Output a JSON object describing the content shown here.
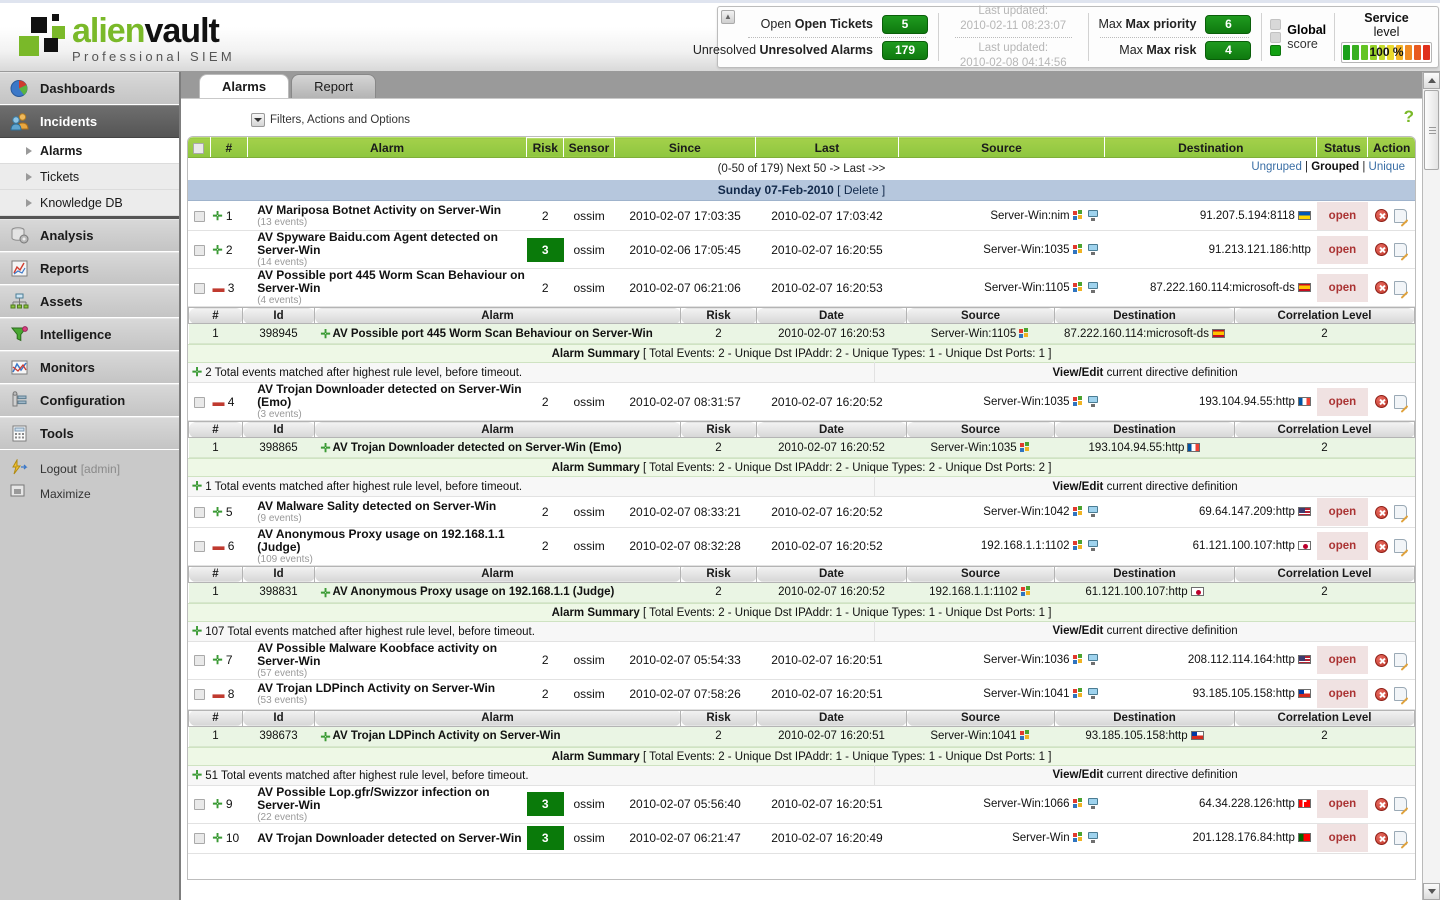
{
  "brand": {
    "name_green": "alien",
    "name_dark": "vault",
    "tagline": "Professional SIEM"
  },
  "status_panel": {
    "open_tickets_label": "Open Tickets",
    "open_tickets_value": "5",
    "unresolved_alarms_label": "Unresolved Alarms",
    "unresolved_alarms_value": "179",
    "last_updated_label_1": "Last updated:",
    "last_updated_value_1": "2010-02-11 08:23:07",
    "last_updated_label_2": "Last updated:",
    "last_updated_value_2": "2010-02-08 04:14:56",
    "max_priority_label": "Max priority",
    "max_priority_value": "6",
    "max_risk_label": "Max risk",
    "max_risk_value": "4",
    "global_label": "Global",
    "score_label": "score",
    "service_label": "Service",
    "level_label": "level",
    "service_level_value": "100 %",
    "pill_color": "#117a11"
  },
  "sidebar": {
    "items": [
      {
        "label": "Dashboards",
        "icon": "pie-chart-icon",
        "active": false
      },
      {
        "label": "Incidents",
        "icon": "people-icon",
        "active": true
      },
      {
        "label": "Analysis",
        "icon": "database-gear-icon",
        "active": false
      },
      {
        "label": "Reports",
        "icon": "report-chart-icon",
        "active": false
      },
      {
        "label": "Assets",
        "icon": "network-nodes-icon",
        "active": false
      },
      {
        "label": "Intelligence",
        "icon": "funnel-icon",
        "active": false
      },
      {
        "label": "Monitors",
        "icon": "line-chart-icon",
        "active": false
      },
      {
        "label": "Configuration",
        "icon": "wrench-icon",
        "active": false
      },
      {
        "label": "Tools",
        "icon": "calculator-icon",
        "active": false
      }
    ],
    "subitems": [
      {
        "label": "Alarms",
        "current": true
      },
      {
        "label": "Tickets",
        "current": false
      },
      {
        "label": "Knowledge DB",
        "current": false
      }
    ],
    "footer": [
      {
        "label": "Logout",
        "suffix": "[admin]",
        "icon": "logout-icon"
      },
      {
        "label": "Maximize",
        "suffix": "",
        "icon": "maximize-icon"
      }
    ]
  },
  "tabs": [
    {
      "label": "Alarms",
      "active": true
    },
    {
      "label": "Report",
      "active": false
    }
  ],
  "help_icon": "?",
  "filters": {
    "label": "Filters, Actions and Options"
  },
  "pager": {
    "text": "(0-50 of 179) Next 50 -> Last ->>",
    "views": [
      "Ungruped",
      "Grouped",
      "Unique"
    ],
    "active_view": "Grouped",
    "separator": "|"
  },
  "table": {
    "headers": [
      "#",
      "Alarm",
      "Risk",
      "Sensor",
      "Since",
      "Last",
      "Source",
      "Destination",
      "Status",
      "Action"
    ],
    "date_group": "Sunday 07-Feb-2010",
    "date_group_delete": "[ Delete ]",
    "sub_headers": [
      "#",
      "Id",
      "Alarm",
      "Risk",
      "Date",
      "Source",
      "Destination",
      "Correlation Level"
    ],
    "view_edit_bold": "View/Edit",
    "view_edit_rest": " current directive definition",
    "rows": [
      {
        "num": "1",
        "sign": "plus",
        "title": "AV Mariposa Botnet Activity on Server-Win",
        "events": "(13 events)",
        "risk": "2",
        "risk_boxed": false,
        "sensor": "ossim",
        "since": "2010-02-07 17:03:35",
        "last": "2010-02-07 17:03:42",
        "source": "Server-Win:nim",
        "source_flag": "",
        "destination": "91.207.5.194:8118",
        "dest_flag": "fl-ua",
        "status": "open"
      },
      {
        "num": "2",
        "sign": "plus",
        "title": "AV Spyware Baidu.com Agent detected on Server-Win",
        "events": "(14 events)",
        "risk": "3",
        "risk_boxed": true,
        "sensor": "ossim",
        "since": "2010-02-06 17:05:45",
        "last": "2010-02-07 16:20:55",
        "source": "Server-Win:1035",
        "source_flag": "",
        "destination": "91.213.121.186:http",
        "dest_flag": "",
        "status": "open"
      },
      {
        "num": "3",
        "sign": "minus",
        "title": "AV Possible port 445 Worm Scan Behaviour on Server-Win",
        "events": "(4 events)",
        "risk": "2",
        "risk_boxed": false,
        "sensor": "ossim",
        "since": "2010-02-07 06:21:06",
        "last": "2010-02-07 16:20:53",
        "source": "Server-Win:1105",
        "source_flag": "",
        "destination": "87.222.160.114:microsoft-ds",
        "dest_flag": "fl-es",
        "status": "open",
        "expanded": {
          "event": {
            "num": "1",
            "id": "398945",
            "alarm": "AV Possible port 445 Worm Scan Behaviour on Server-Win",
            "risk": "2",
            "date": "2010-02-07 16:20:53",
            "source": "Server-Win:1105",
            "destination": "87.222.160.114:microsoft-ds",
            "dest_flag": "fl-es",
            "correlation_level": "2"
          },
          "summary_bold": "Alarm Summary",
          "summary_rest": " [ Total Events: 2 - Unique Dst IPAddr: 2 - Unique Types: 1 - Unique Dst Ports: 1 ]",
          "match_text": "2 Total events matched after highest rule level, before timeout."
        }
      },
      {
        "num": "4",
        "sign": "minus",
        "title": "AV Trojan Downloader detected on Server-Win (Emo)",
        "events": "(3 events)",
        "risk": "2",
        "risk_boxed": false,
        "sensor": "ossim",
        "since": "2010-02-07 08:31:57",
        "last": "2010-02-07 16:20:52",
        "source": "Server-Win:1035",
        "source_flag": "",
        "destination": "193.104.94.55:http",
        "dest_flag": "fl-fr",
        "status": "open",
        "expanded": {
          "event": {
            "num": "1",
            "id": "398865",
            "alarm": "AV Trojan Downloader detected on Server-Win (Emo)",
            "risk": "2",
            "date": "2010-02-07 16:20:52",
            "source": "Server-Win:1035",
            "destination": "193.104.94.55:http",
            "dest_flag": "fl-fr",
            "correlation_level": "2"
          },
          "summary_bold": "Alarm Summary",
          "summary_rest": " [ Total Events: 2 - Unique Dst IPAddr: 2 - Unique Types: 2 - Unique Dst Ports: 2 ]",
          "match_text": "1 Total events matched after highest rule level, before timeout."
        }
      },
      {
        "num": "5",
        "sign": "plus",
        "title": "AV Malware Sality detected on Server-Win",
        "events": "(9 events)",
        "risk": "2",
        "risk_boxed": false,
        "sensor": "ossim",
        "since": "2010-02-07 08:33:21",
        "last": "2010-02-07 16:20:52",
        "source": "Server-Win:1042",
        "source_flag": "",
        "destination": "69.64.147.209:http",
        "dest_flag": "fl-us",
        "status": "open"
      },
      {
        "num": "6",
        "sign": "minus",
        "title": "AV Anonymous Proxy usage on 192.168.1.1 (Judge)",
        "events": "(109 events)",
        "risk": "2",
        "risk_boxed": false,
        "sensor": "ossim",
        "since": "2010-02-07 08:32:28",
        "last": "2010-02-07 16:20:52",
        "source": "192.168.1.1:1102",
        "source_flag": "",
        "destination": "61.121.100.107:http",
        "dest_flag": "fl-jp",
        "status": "open",
        "expanded": {
          "event": {
            "num": "1",
            "id": "398831",
            "alarm": "AV Anonymous Proxy usage on 192.168.1.1 (Judge)",
            "risk": "2",
            "date": "2010-02-07 16:20:52",
            "source": "192.168.1.1:1102",
            "destination": "61.121.100.107:http",
            "dest_flag": "fl-jp",
            "correlation_level": "2"
          },
          "summary_bold": "Alarm Summary",
          "summary_rest": " [ Total Events: 2 - Unique Dst IPAddr: 1 - Unique Types: 1 - Unique Dst Ports: 1 ]",
          "match_text": "107 Total events matched after highest rule level, before timeout."
        }
      },
      {
        "num": "7",
        "sign": "plus",
        "title": "AV Possible Malware Koobface activity on Server-Win",
        "events": "(57 events)",
        "risk": "2",
        "risk_boxed": false,
        "sensor": "ossim",
        "since": "2010-02-07 05:54:33",
        "last": "2010-02-07 16:20:51",
        "source": "Server-Win:1036",
        "source_flag": "",
        "destination": "208.112.114.164:http",
        "dest_flag": "fl-us",
        "status": "open"
      },
      {
        "num": "8",
        "sign": "minus",
        "title": "AV Trojan LDPinch Activity on Server-Win",
        "events": "(53 events)",
        "risk": "2",
        "risk_boxed": false,
        "sensor": "ossim",
        "since": "2010-02-07 07:58:26",
        "last": "2010-02-07 16:20:51",
        "source": "Server-Win:1041",
        "source_flag": "",
        "destination": "93.185.105.158:http",
        "dest_flag": "fl-cl",
        "status": "open",
        "expanded": {
          "event": {
            "num": "1",
            "id": "398673",
            "alarm": "AV Trojan LDPinch Activity on Server-Win",
            "risk": "2",
            "date": "2010-02-07 16:20:51",
            "source": "Server-Win:1041",
            "destination": "93.185.105.158:http",
            "dest_flag": "fl-cl",
            "correlation_level": "2"
          },
          "summary_bold": "Alarm Summary",
          "summary_rest": " [ Total Events: 2 - Unique Dst IPAddr: 1 - Unique Types: 1 - Unique Dst Ports: 1 ]",
          "match_text": "51 Total events matched after highest rule level, before timeout."
        }
      },
      {
        "num": "9",
        "sign": "plus",
        "title": "AV Possible Lop.gfr/Swizzor infection on Server-Win",
        "events": "(22 events)",
        "risk": "3",
        "risk_boxed": true,
        "sensor": "ossim",
        "since": "2010-02-07 05:56:40",
        "last": "2010-02-07 16:20:51",
        "source": "Server-Win:1066",
        "source_flag": "",
        "destination": "64.34.228.126:http",
        "dest_flag": "fl-ca",
        "status": "open"
      },
      {
        "num": "10",
        "sign": "plus",
        "title": "AV Trojan Downloader detected on Server-Win",
        "events": "",
        "risk": "3",
        "risk_boxed": true,
        "sensor": "ossim",
        "since": "2010-02-07 06:21:47",
        "last": "2010-02-07 16:20:49",
        "source": "Server-Win",
        "source_flag": "",
        "destination": "201.128.176.84:http",
        "dest_flag": "fl-pt",
        "status": "open"
      }
    ]
  }
}
